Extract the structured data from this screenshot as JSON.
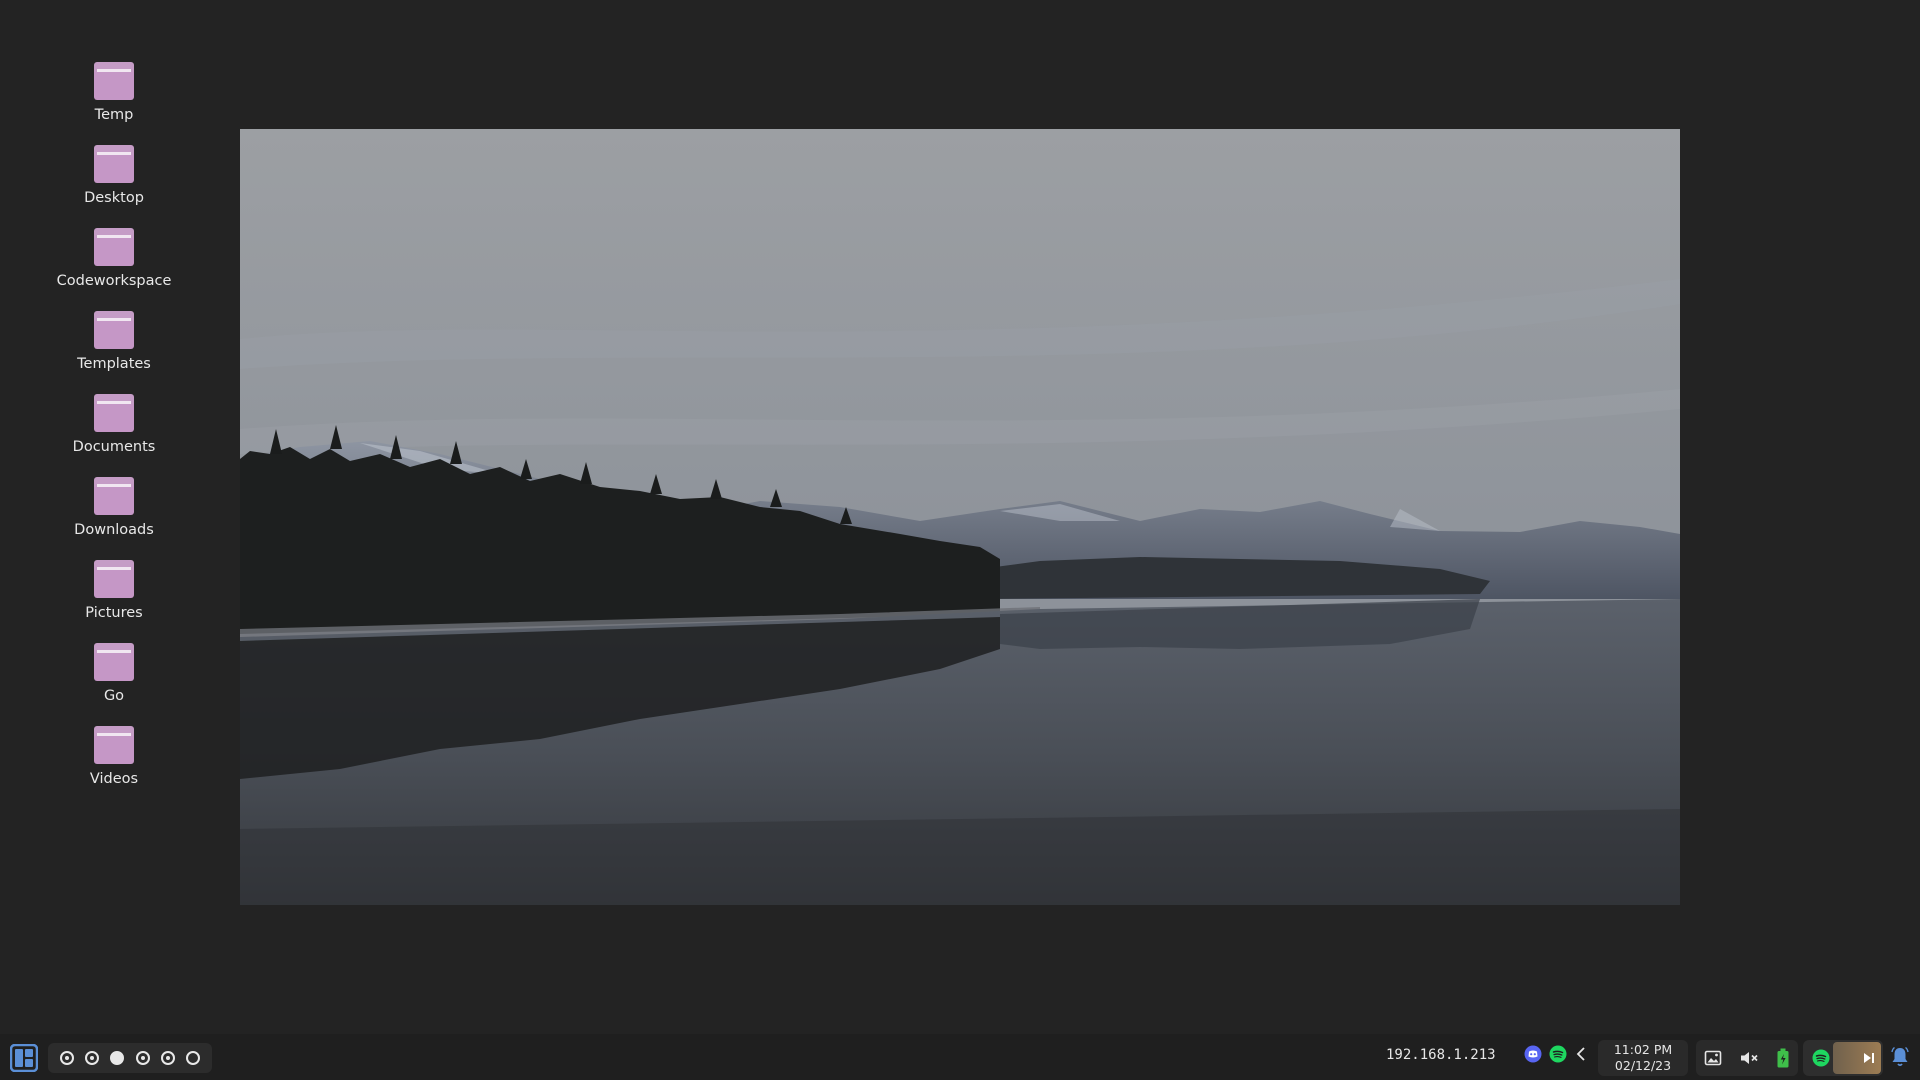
{
  "desktop": {
    "icons": [
      {
        "label": "Temp",
        "icon": "folder-icon"
      },
      {
        "label": "Desktop",
        "icon": "folder-icon"
      },
      {
        "label": "Codeworkspace",
        "icon": "folder-icon"
      },
      {
        "label": "Templates",
        "icon": "folder-icon"
      },
      {
        "label": "Documents",
        "icon": "folder-icon"
      },
      {
        "label": "Downloads",
        "icon": "folder-icon"
      },
      {
        "label": "Pictures",
        "icon": "folder-icon"
      },
      {
        "label": "Go",
        "icon": "folder-icon"
      },
      {
        "label": "Videos",
        "icon": "folder-icon"
      }
    ],
    "folder_color": "#c597c6",
    "background_color": "#232323"
  },
  "wallpaper": {
    "subject": "lake with forested shore and snow-dusted mountains under overcast sky"
  },
  "taskbar": {
    "start_icon": "layout-grid-icon",
    "workspaces": [
      {
        "state": "dot"
      },
      {
        "state": "dot"
      },
      {
        "state": "active"
      },
      {
        "state": "dot"
      },
      {
        "state": "dot"
      },
      {
        "state": "empty"
      }
    ],
    "ip_address": "192.168.1.213",
    "tray_apps": [
      "discord-icon",
      "spotify-icon",
      "chevron-left-icon"
    ],
    "clock": {
      "time": "11:02 PM",
      "date": "02/12/23"
    },
    "system_tray": [
      "screenshot-icon",
      "volume-muted-icon",
      "battery-charging-icon"
    ],
    "media": [
      "spotify-icon",
      "skip-next-icon"
    ],
    "notification_icon": "bell-icon",
    "accent_color": "#5b8fd6",
    "discord_color": "#5865f2",
    "spotify_color": "#1ed760",
    "battery_color": "#3fbf4a"
  }
}
